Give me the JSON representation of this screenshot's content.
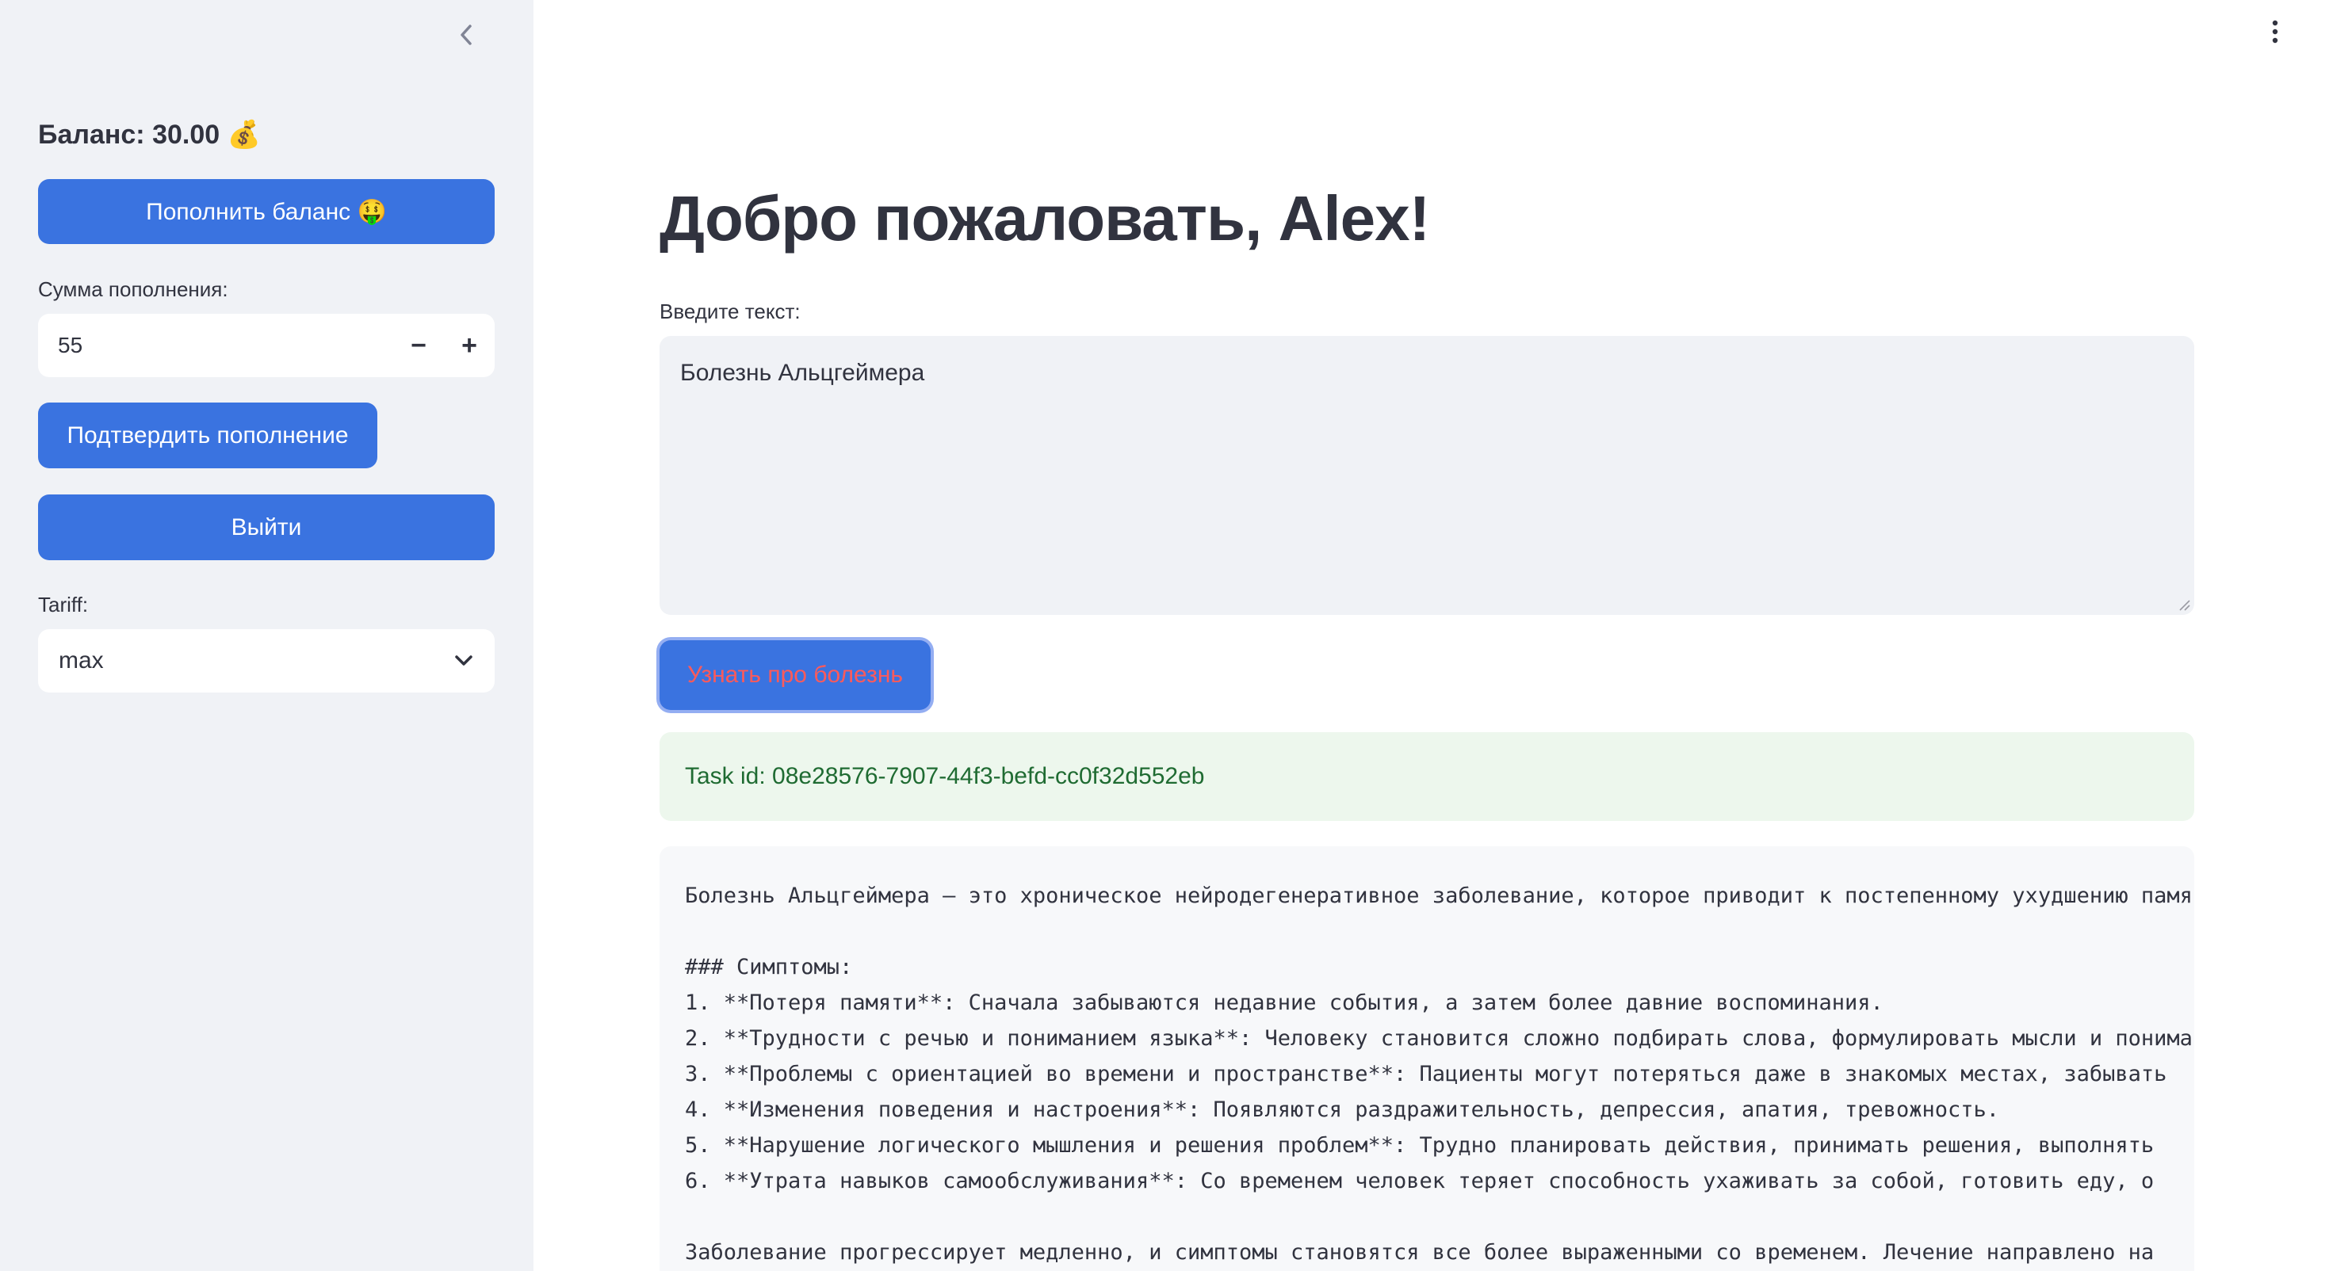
{
  "sidebar": {
    "balance_text": "Баланс: 30.00 💰",
    "topup_button": "Пополнить баланс 🤑",
    "amount_label": "Сумма пополнения:",
    "amount_value": "55",
    "decrement": "−",
    "increment": "+",
    "confirm_button": "Подтвердить пополнение",
    "logout_button": "Выйти",
    "tariff_label": "Tariff:",
    "tariff_value": "max"
  },
  "main": {
    "title": "Добро пожаловать, Alex!",
    "input_label": "Введите текст:",
    "input_value": "Болезнь Альцгеймера",
    "ask_button": "Узнать про болезнь",
    "task_message": "Task id: 08e28576-7907-44f3-befd-cc0f32d552eb",
    "response_lines": [
      "Болезнь Альцгеймера — это хроническое нейродегенеративное заболевание, которое приводит к постепенному ухудшению памяти",
      "",
      "### Симптомы:",
      "1. **Потеря памяти**: Сначала забываются недавние события, а затем более давние воспоминания.",
      "2. **Трудности с речью и пониманием языка**: Человеку становится сложно подбирать слова, формулировать мысли и понимать",
      "3. **Проблемы с ориентацией во времени и пространстве**: Пациенты могут потеряться даже в знакомых местах, забывать",
      "4. **Изменения поведения и настроения**: Появляются раздражительность, депрессия, апатия, тревожность.",
      "5. **Нарушение логического мышления и решения проблем**: Трудно планировать действия, принимать решения, выполнять",
      "6. **Утрата навыков самообслуживания**: Со временем человек теряет способность ухаживать за собой, готовить еду, о",
      "",
      "Заболевание прогрессирует медленно, и симптомы становятся все более выраженными со временем. Лечение направлено на"
    ]
  },
  "colors": {
    "primary": "#3a73e0",
    "sidebar_bg": "#f0f2f6",
    "success_bg": "#edf7ed",
    "success_text": "#1f6b32",
    "ask_button_text": "#ff5a5a"
  }
}
